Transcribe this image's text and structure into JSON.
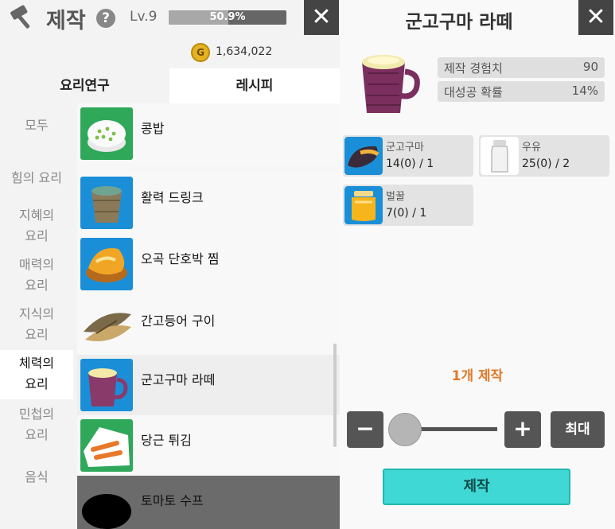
{
  "header": {
    "title": "제작",
    "help_label": "?",
    "level": "Lv.9",
    "exp_percent": 50.9,
    "exp_label": "50.9%",
    "close_label": "✕",
    "gold_label": "G",
    "gold": "1,634,022"
  },
  "tabs": [
    "요리연구",
    "레시피"
  ],
  "categories": [
    "모두",
    "힘의 요리",
    "지혜의\n요리",
    "매력의\n요리",
    "지식의\n요리",
    "체력의\n요리",
    "민첩의\n요리",
    "음식"
  ],
  "recipes": [
    {
      "name": "콩밥",
      "icon": "bean-rice-icon"
    },
    {
      "name": "활력 드링크",
      "icon": "vitality-drink-icon"
    },
    {
      "name": "오곡 단호박 찜",
      "icon": "steamed-pumpkin-icon"
    },
    {
      "name": "간고등어 구이",
      "icon": "grilled-mackerel-icon"
    },
    {
      "name": "군고구마 라떼",
      "icon": "sweet-potato-latte-icon"
    },
    {
      "name": "당근 튀김",
      "icon": "fried-carrot-icon"
    },
    {
      "name": "토마토 수프",
      "icon": "tomato-soup-icon"
    }
  ],
  "detail": {
    "title": "군고구마 라떼",
    "close_label": "✕",
    "stats": [
      {
        "label": "제작 경험치",
        "value": "90"
      },
      {
        "label": "대성공 확률",
        "value": "14%"
      }
    ],
    "materials": [
      {
        "name": "군고구마",
        "count": "14(0) / 1",
        "icon": "roasted-sweet-potato-icon"
      },
      {
        "name": "우유",
        "count": "25(0) / 2",
        "icon": "milk-bottle-icon"
      },
      {
        "name": "벌꿀",
        "count": "7(0) / 1",
        "icon": "honey-jar-icon"
      }
    ],
    "craft_count_label": "1개 제작",
    "minus_label": "−",
    "plus_label": "+",
    "max_label": "최대",
    "craft_label": "제작",
    "slider_fraction": 0
  },
  "colors": {
    "accent_cyan": "#3fd8d4",
    "accent_orange": "#e07a2a",
    "icon_blue": "#1a8fd8",
    "icon_green": "#2fa85a"
  }
}
